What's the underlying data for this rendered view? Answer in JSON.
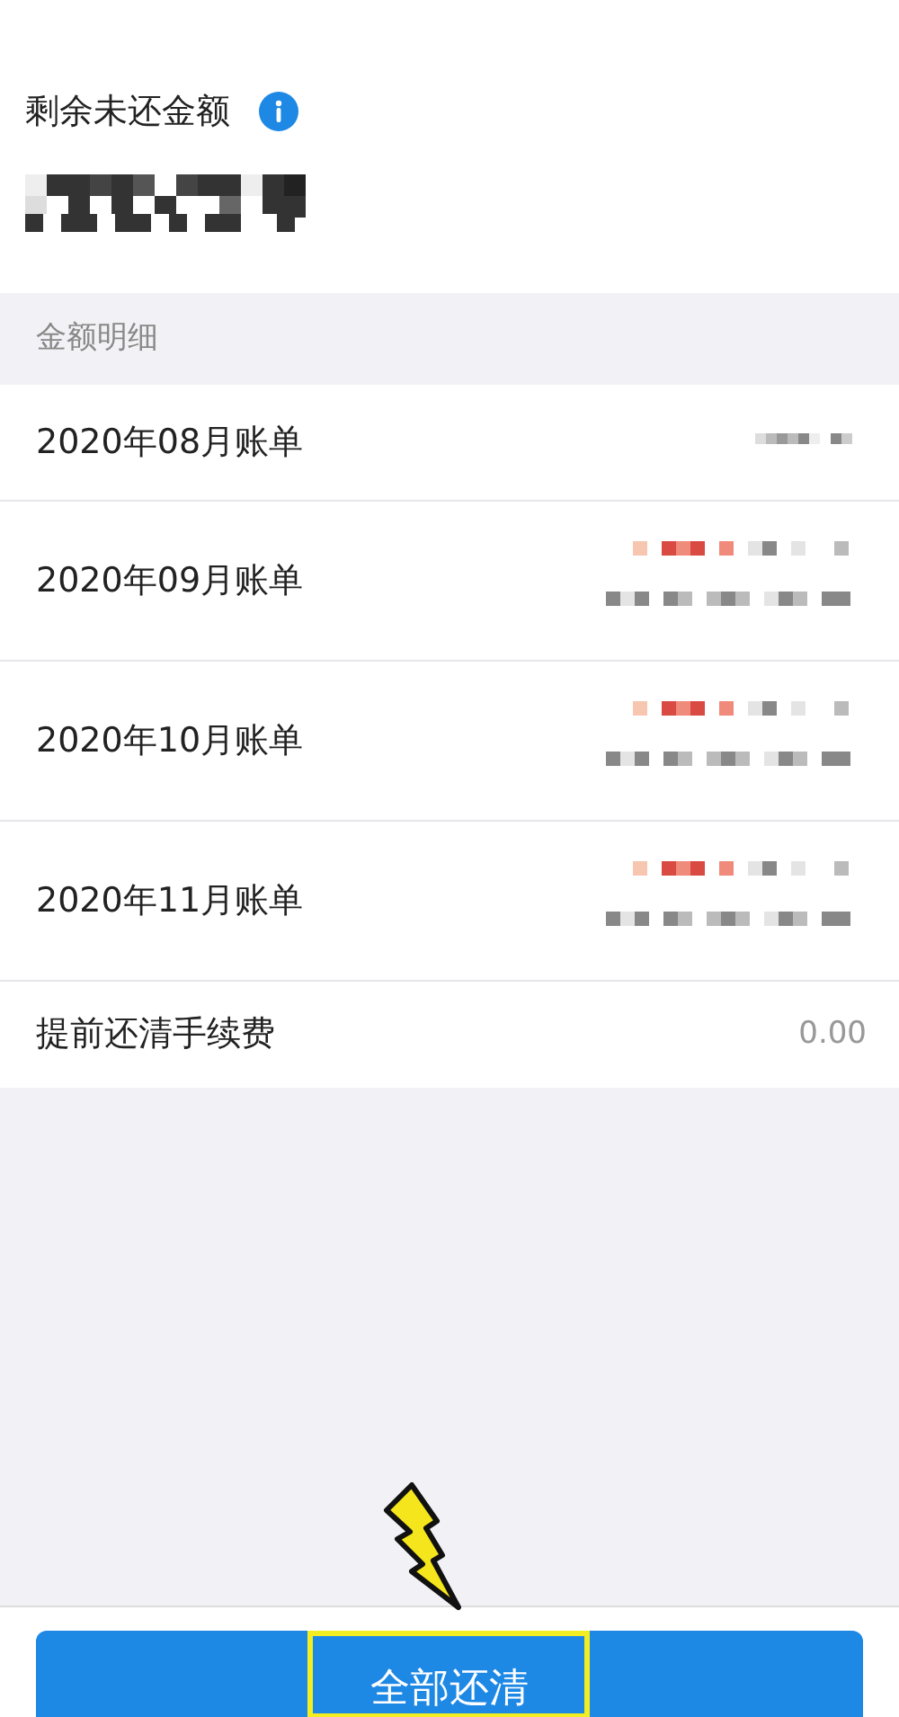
{
  "balance": {
    "label": "剩余未还金额"
  },
  "details": {
    "header": "金额明细",
    "rows": [
      {
        "label": "2020年08月账单",
        "kind": "redacted_single"
      },
      {
        "label": "2020年09月账单",
        "kind": "redacted_double"
      },
      {
        "label": "2020年10月账单",
        "kind": "redacted_double"
      },
      {
        "label": "2020年11月账单",
        "kind": "redacted_double"
      },
      {
        "label": "提前还清手续费",
        "kind": "amount",
        "value": "0.00"
      }
    ]
  },
  "footer": {
    "button": "全部还清"
  }
}
